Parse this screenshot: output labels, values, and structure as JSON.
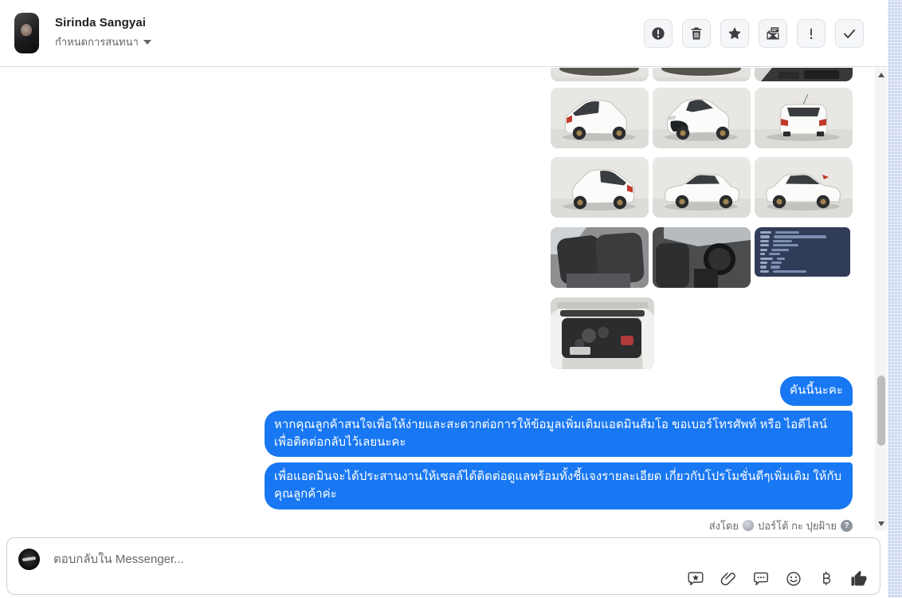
{
  "header": {
    "name": "Sirinda Sangyai",
    "subtitle": "กำหนดการสนทนา",
    "actions": [
      {
        "icon": "report-icon"
      },
      {
        "icon": "trash-icon"
      },
      {
        "icon": "star-icon"
      },
      {
        "icon": "mark-unread-icon"
      },
      {
        "icon": "exclamation-icon"
      },
      {
        "icon": "mark-done-icon"
      }
    ]
  },
  "conversation": {
    "photo_grid": {
      "rows": [
        [
          "car-underside-photo",
          "car-underside-photo",
          "interior-dark-partial-photo"
        ],
        [
          "car-rear-quarter-photo",
          "car-front-quarter-photo",
          "car-rear-photo"
        ],
        [
          "car-rear-quarter-left-photo",
          "car-side-photo",
          "car-side-left-photo"
        ],
        [
          "interior-rear-seats-photo",
          "interior-dashboard-photo",
          "spec-sheet-card"
        ],
        [
          "engine-bay-photo"
        ]
      ]
    },
    "messages": [
      {
        "type": "text",
        "text": "คันนี้นะคะ"
      },
      {
        "type": "text",
        "text": "หากคุณลูกค้าสนใจเพื่อให้ง่ายและสะดวกต่อการให้ข้อมูลเพิ่มเติมแอดมินส้มโอ ขอเบอร์โทรศัพท์ หรือ ไอดีไลน์เพื่อติดต่อกลับไว้เลยนะคะ"
      },
      {
        "type": "text",
        "text": "เพื่อแอดมินจะได้ประสานงานให้เซลล์ได้ติดต่อดูแลพร้อมทั้งชี้แจงรายละเอียด เกี่ยวกับโปรโมชั่นดีๆเพิ่มเติม ให้กับคุณลูกค้าค่ะ"
      }
    ],
    "sent_by": {
      "label": "ส่งโดย",
      "sender": "ปอร์โต้ กะ ปุยฝ้าย",
      "help_glyph": "?"
    }
  },
  "composer": {
    "placeholder": "ตอบกลับใน Messenger...",
    "icons": [
      "sticker-icon",
      "attachment-icon",
      "saved-replies-icon",
      "emoji-icon",
      "payment-baht-icon",
      "like-icon"
    ]
  },
  "colors": {
    "bubble_blue": "#1877f2",
    "spec_card_bg": "#313d58",
    "right_strip": "#ccd8f1",
    "secondary_text": "#65676b"
  }
}
